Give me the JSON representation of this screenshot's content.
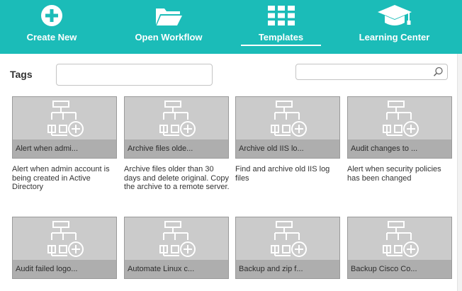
{
  "nav": {
    "items": [
      {
        "label": "Create New",
        "icon": "plus-circle-icon"
      },
      {
        "label": "Open Workflow",
        "icon": "folder-open-icon"
      },
      {
        "label": "Templates",
        "icon": "grid-icon"
      },
      {
        "label": "Learning Center",
        "icon": "graduation-cap-icon"
      }
    ],
    "active": "Templates"
  },
  "filters": {
    "tags_label": "Tags",
    "tags_value": "",
    "search_value": ""
  },
  "templates": [
    {
      "title": "Alert when admi...",
      "description": "Alert when admin account is being created in Active Directory"
    },
    {
      "title": "Archive files olde...",
      "description": "Archive files older than 30 days and delete original. Copy the archive to a remote server."
    },
    {
      "title": "Archive old IIS lo...",
      "description": "Find and archive old IIS log files"
    },
    {
      "title": "Audit changes to ...",
      "description": "Alert when security policies has been changed"
    },
    {
      "title": "Audit failed logo...",
      "description": ""
    },
    {
      "title": "Automate Linux c...",
      "description": ""
    },
    {
      "title": "Backup and zip f...",
      "description": ""
    },
    {
      "title": "Backup Cisco Co...",
      "description": ""
    }
  ],
  "colors": {
    "header_bg": "#1bbcb8",
    "card_bg": "#cbcbcb",
    "card_title_bg": "#aeaeae"
  }
}
